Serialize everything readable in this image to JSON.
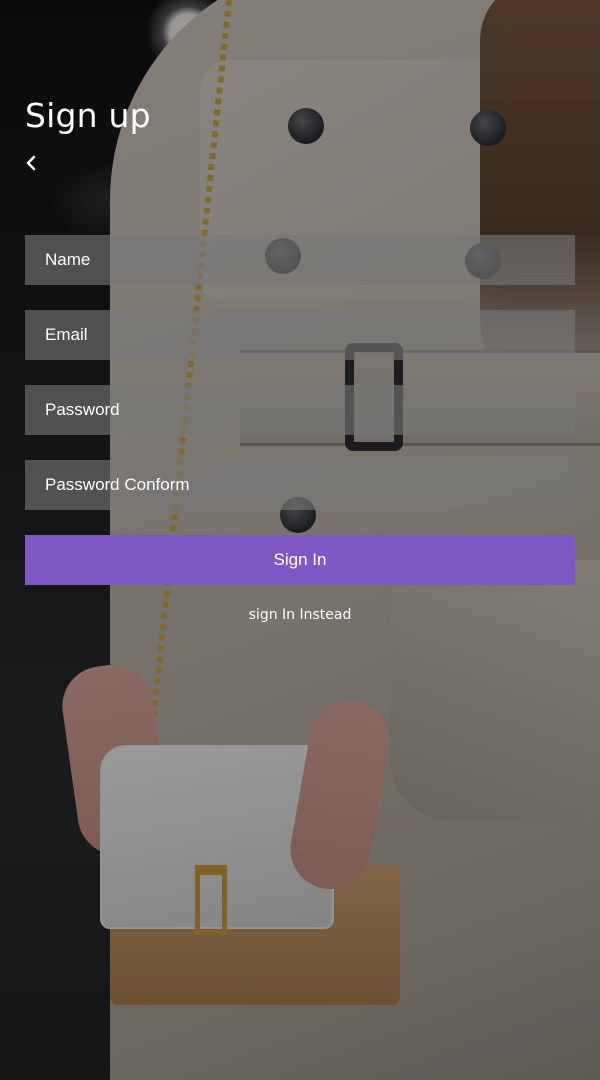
{
  "page": {
    "title": "Sign up",
    "accent_color": "#7e57c2",
    "field_background": "rgba(120,120,120,0.62)"
  },
  "nav": {
    "back_icon": "chevron-left-icon"
  },
  "form": {
    "name_placeholder": "Name",
    "email_placeholder": "Email",
    "password_placeholder": "Password",
    "password_confirm_placeholder": "Password Conform",
    "submit_label": "Sign In",
    "alt_link_label": "sign In Instead"
  },
  "background": {
    "description_icon": "photo-background"
  }
}
